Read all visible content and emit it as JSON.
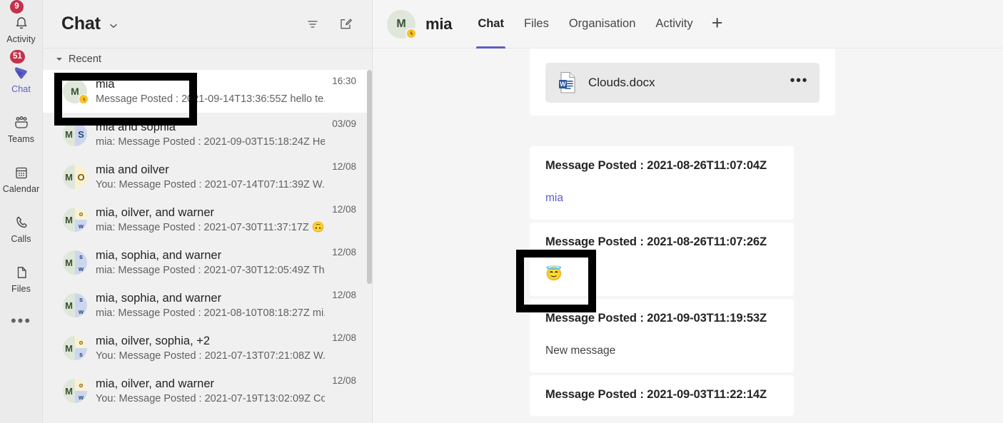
{
  "app": {
    "name": "Microsoft Teams",
    "accent_color": "#5b5fc7",
    "badge_color": "#c4314b",
    "away_color": "#f8c12c"
  },
  "rail": {
    "items": [
      {
        "label": "Activity",
        "icon": "bell-icon",
        "badge": "9",
        "active": false
      },
      {
        "label": "Chat",
        "icon": "chat-icon",
        "badge": "51",
        "active": true
      },
      {
        "label": "Teams",
        "icon": "teams-icon",
        "badge": "",
        "active": false
      },
      {
        "label": "Calendar",
        "icon": "calendar-icon",
        "badge": "",
        "active": false
      },
      {
        "label": "Calls",
        "icon": "phone-icon",
        "badge": "",
        "active": false
      },
      {
        "label": "Files",
        "icon": "file-icon",
        "badge": "",
        "active": false
      }
    ],
    "more_label": "•••"
  },
  "chat_list": {
    "title": "Chat",
    "title_chevron": "chevron-down-icon",
    "filter_icon": "filter-icon",
    "compose_icon": "new-chat-icon",
    "group_label": "Recent",
    "rows": [
      {
        "name": "mia",
        "preview": "Message Posted : 2021-09-14T13:36:55Z hello te...",
        "time": "16:30",
        "selected": true,
        "presence": "away",
        "avatar": {
          "type": "single",
          "initials": [
            "M"
          ]
        }
      },
      {
        "name": "mia and sophia",
        "preview": "mia: Message Posted : 2021-09-03T15:18:24Z He...",
        "time": "03/09",
        "selected": false,
        "presence": "none",
        "avatar": {
          "type": "duo",
          "initials": [
            "M",
            "S"
          ]
        }
      },
      {
        "name": "mia and oilver",
        "preview": "You: Message Posted : 2021-07-14T07:11:39Z W...",
        "time": "12/08",
        "selected": false,
        "presence": "none",
        "avatar": {
          "type": "duo",
          "initials": [
            "M",
            "O"
          ]
        }
      },
      {
        "name": "mia, oilver, and warner",
        "preview": "mia: Message Posted : 2021-07-30T11:37:17Z 🙃",
        "time": "12/08",
        "selected": false,
        "presence": "none",
        "avatar": {
          "type": "trio",
          "initials": [
            "M",
            "o",
            "w"
          ]
        }
      },
      {
        "name": "mia, sophia, and warner",
        "preview": "mia: Message Posted : 2021-07-30T12:05:49Z Th...",
        "time": "12/08",
        "selected": false,
        "presence": "none",
        "avatar": {
          "type": "trio",
          "initials": [
            "M",
            "s",
            "w"
          ]
        }
      },
      {
        "name": "mia, sophia, and warner",
        "preview": "mia: Message Posted : 2021-08-10T08:18:27Z mi...",
        "time": "12/08",
        "selected": false,
        "presence": "none",
        "avatar": {
          "type": "trio",
          "initials": [
            "M",
            "s",
            "w"
          ]
        }
      },
      {
        "name": "mia, oilver, sophia, +2",
        "preview": "You: Message Posted : 2021-07-13T07:21:08Z W...",
        "time": "12/08",
        "selected": false,
        "presence": "none",
        "avatar": {
          "type": "trio",
          "initials": [
            "M",
            "o",
            "s"
          ]
        }
      },
      {
        "name": "mia, oilver, and warner",
        "preview": "You: Message Posted : 2021-07-19T13:02:09Z Co...",
        "time": "12/08",
        "selected": false,
        "presence": "none",
        "avatar": {
          "type": "trio",
          "initials": [
            "M",
            "o",
            "w"
          ]
        }
      }
    ]
  },
  "conversation": {
    "peer_name": "mia",
    "peer_initials": "M",
    "peer_presence": "away",
    "tabs": [
      {
        "label": "Chat",
        "active": true
      },
      {
        "label": "Files",
        "active": false
      },
      {
        "label": "Organisation",
        "active": false
      },
      {
        "label": "Activity",
        "active": false
      }
    ],
    "add_tab_label": "+",
    "messages": [
      {
        "id": "msg-attachment",
        "title_clipped": true,
        "title": "",
        "attachment": {
          "name": "Clouds.docx",
          "icon": "word-document-icon",
          "more_label": "•••"
        }
      },
      {
        "id": "msg-1",
        "title": "Message Posted : 2021-08-26T11:07:04Z",
        "body": "mia",
        "body_kind": "mention"
      },
      {
        "id": "msg-2",
        "title": "Message Posted : 2021-08-26T11:07:26Z",
        "body": "😇",
        "body_kind": "emoji"
      },
      {
        "id": "msg-3",
        "title": "Message Posted : 2021-09-03T11:19:53Z",
        "body": "New message",
        "body_kind": "text"
      },
      {
        "id": "msg-4",
        "title": "Message Posted : 2021-09-03T11:22:14Z",
        "body": "",
        "body_kind": "text"
      }
    ]
  },
  "annotations": [
    {
      "name": "highlight-chat-row-mia",
      "target": "chat-row-0"
    },
    {
      "name": "highlight-emoji-message",
      "target": "msg-2-body"
    }
  ]
}
